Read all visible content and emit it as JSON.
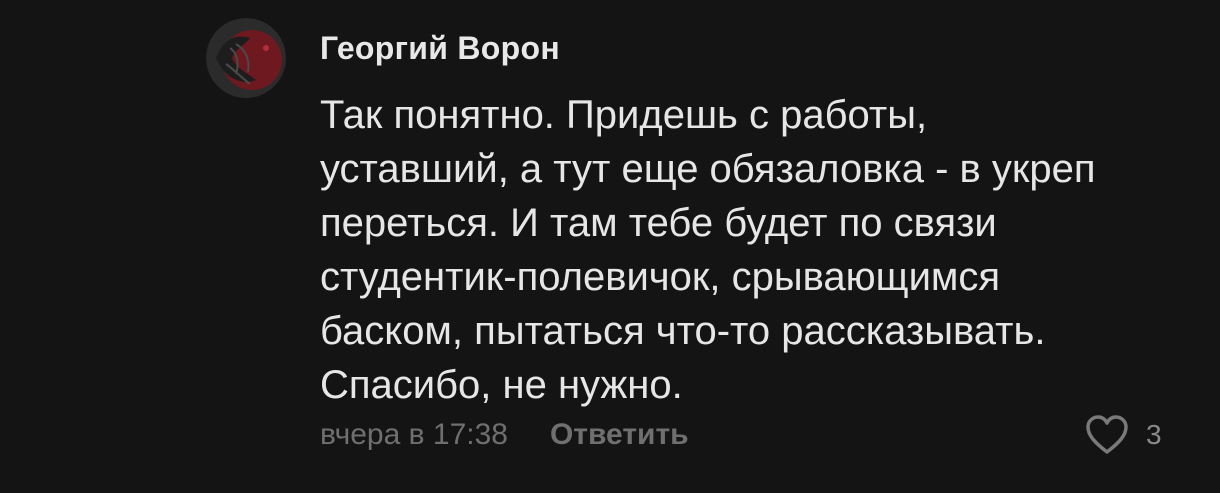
{
  "comment": {
    "author": "Георгий Ворон",
    "text": "Так понятно. Придешь с работы,\nуставший, а тут еще обязаловка - в укреп\nпереться. И там тебе будет по связи\nстудентик-полевичок, срывающимся\nбаском, пытаться что-то рассказывать.\nСпасибо, не нужно.",
    "timestamp": "вчера в 17:38",
    "reply_label": "Ответить",
    "like_count": "3",
    "like_icon": "heart-outline-icon"
  }
}
